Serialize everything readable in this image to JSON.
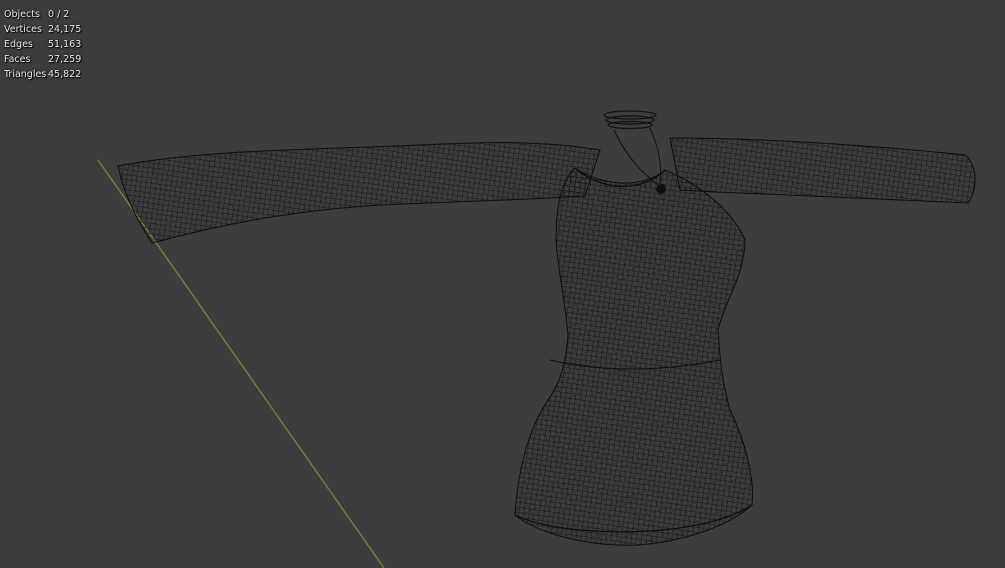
{
  "stats": [
    {
      "label": "Objects",
      "value": "0 / 2"
    },
    {
      "label": "Vertices",
      "value": "24,175"
    },
    {
      "label": "Edges",
      "value": "51,163"
    },
    {
      "label": "Faces",
      "value": "27,259"
    },
    {
      "label": "Triangles",
      "value": "45,822"
    }
  ],
  "colors": {
    "background": "#3d3d3d",
    "wire": "#0d0d0d",
    "y_axis": "#6f8a33"
  },
  "icons": {
    "necklace": "necklace-icon"
  }
}
